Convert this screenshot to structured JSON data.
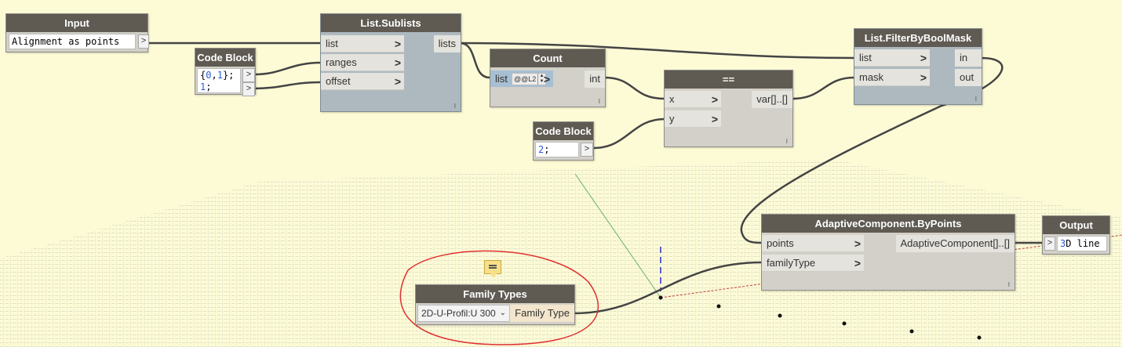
{
  "nodes": {
    "input": {
      "title": "Input",
      "value": "Alignment as points",
      "out_arrow": ">"
    },
    "code_block_1": {
      "title": "Code Block",
      "line1_open": "{",
      "line1_a": "0",
      "line1_sep": ",",
      "line1_b": "1",
      "line1_close": "};",
      "line2_num": "1",
      "line2_rest": ";",
      "arrow": ">"
    },
    "sublists": {
      "title": "List.Sublists",
      "inputs": [
        "list",
        "ranges",
        "offset"
      ],
      "output": "lists"
    },
    "count": {
      "title": "Count",
      "input": "list",
      "lacing": "@@L2",
      "output": "int"
    },
    "equals": {
      "title": "==",
      "inputs": [
        "x",
        "y"
      ],
      "output": "var[]..[]"
    },
    "code_block_2": {
      "title": "Code Block",
      "num": "2",
      "rest": ";",
      "arrow": ">"
    },
    "filter": {
      "title": "List.FilterByBoolMask",
      "inputs": [
        "list",
        "mask"
      ],
      "outputs": [
        "in",
        "out"
      ]
    },
    "adaptive": {
      "title": "AdaptiveComponent.ByPoints",
      "inputs": [
        "points",
        "familyType"
      ],
      "output": "AdaptiveComponent[]..[]"
    },
    "output": {
      "title": "Output",
      "arrow": ">",
      "num": "3",
      "rest": "D line"
    },
    "family_types": {
      "title": "Family Types",
      "selected": "2D-U-Profil:U 300",
      "output": "Family Type"
    }
  },
  "chevron": ">",
  "lace_glyph": "I",
  "colors": {
    "canvas": "#fdfbd6",
    "node_header": "#5f5a52",
    "wire": "#444444",
    "highlight": "#e03030"
  }
}
